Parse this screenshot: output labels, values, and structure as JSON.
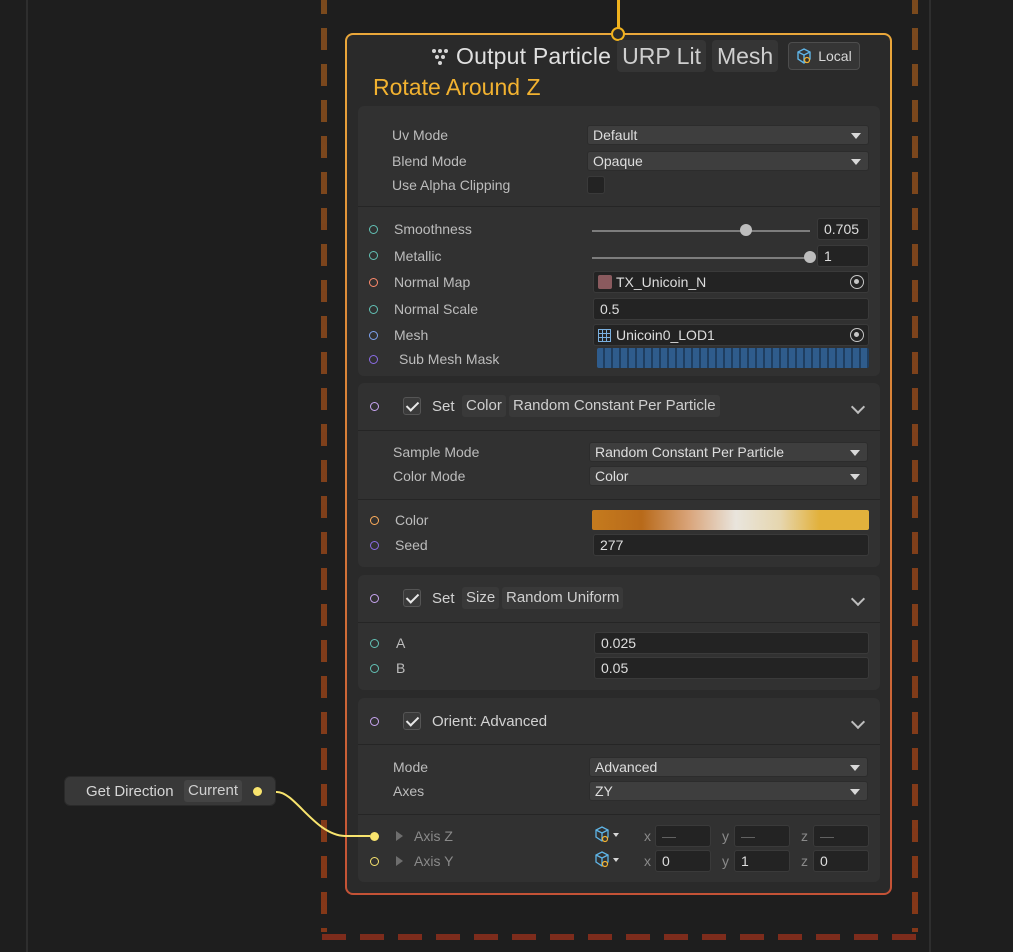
{
  "context": {
    "title": "Output Particle",
    "tags": [
      "URP Lit",
      "Mesh"
    ],
    "space_label": "Local",
    "subtitle": "Rotate Around Z"
  },
  "settings": {
    "uv_mode": {
      "label": "Uv Mode",
      "value": "Default"
    },
    "blend_mode": {
      "label": "Blend Mode",
      "value": "Opaque"
    },
    "alpha_clip": {
      "label": "Use Alpha Clipping",
      "checked": false
    }
  },
  "properties": {
    "smoothness": {
      "label": "Smoothness",
      "value": "0.705",
      "fraction": 0.705
    },
    "metallic": {
      "label": "Metallic",
      "value": "1",
      "fraction": 1
    },
    "normal_map": {
      "label": "Normal Map",
      "value": "TX_Unicoin_N"
    },
    "normal_scale": {
      "label": "Normal Scale",
      "value": "0.5"
    },
    "mesh": {
      "label": "Mesh",
      "value": "Unicoin0_LOD1"
    },
    "sub_mesh_mask": {
      "label": "Sub Mesh Mask"
    }
  },
  "set_color": {
    "words": [
      "Set",
      "Color"
    ],
    "mode_tag": "Random Constant Per Particle",
    "sample_mode": {
      "label": "Sample Mode",
      "value": "Random Constant Per Particle"
    },
    "color_mode": {
      "label": "Color Mode",
      "value": "Color"
    },
    "color": {
      "label": "Color"
    },
    "seed": {
      "label": "Seed",
      "value": "277"
    }
  },
  "set_size": {
    "words": [
      "Set",
      "Size"
    ],
    "mode_tag": "Random Uniform",
    "a": {
      "label": "A",
      "value": "0.025"
    },
    "b": {
      "label": "B",
      "value": "0.05"
    }
  },
  "orient": {
    "title": "Orient: Advanced",
    "mode": {
      "label": "Mode",
      "value": "Advanced"
    },
    "axes": {
      "label": "Axes",
      "value": "ZY"
    },
    "axis_z": {
      "label": "Axis Z",
      "x": "—",
      "y": "—",
      "z": "—"
    },
    "axis_y": {
      "label": "Axis Y",
      "x": "0",
      "y": "1",
      "z": "0"
    },
    "comp_labels": [
      "x",
      "y",
      "z"
    ]
  },
  "get_direction": {
    "label": "Get Direction",
    "tag": "Current"
  },
  "colors": {
    "port_cyan": "#63c2b6",
    "port_orange": "#ff8a6c",
    "port_blue": "#7ea3f0",
    "port_purple": "#8b6ce6",
    "port_pink": "#c9a6f2",
    "port_yellow": "#f8e46e",
    "accent": "#f2b230"
  }
}
